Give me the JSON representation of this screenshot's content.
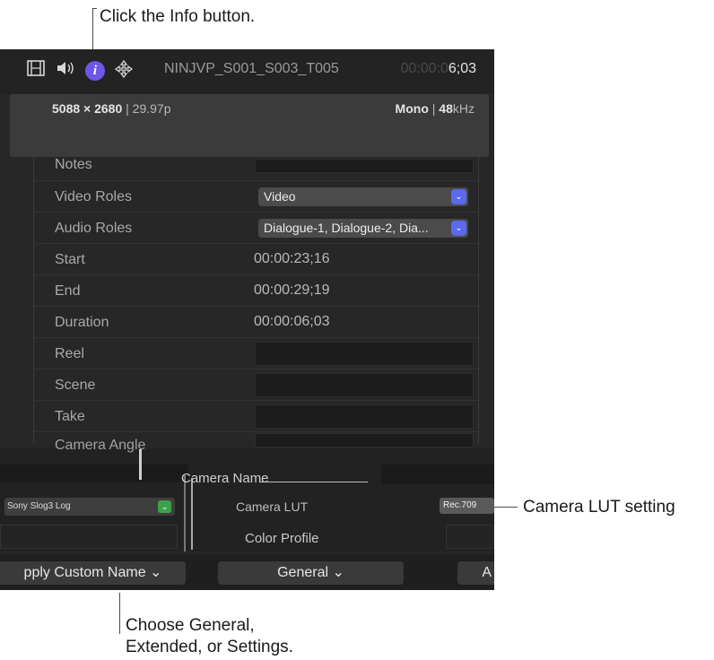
{
  "callouts": {
    "info": "Click the Info button.",
    "lut": "Camera LUT setting",
    "general_line1": "Choose General,",
    "general_line2": "Extended, or Settings."
  },
  "header": {
    "icons": [
      "film-icon",
      "speaker-icon",
      "info-icon",
      "transform-icon"
    ],
    "info_glyph": "i",
    "clip_name": "NINJVP_S001_S003_T005",
    "timecode_dim": "00:00:0",
    "timecode_bright": "6;03"
  },
  "summary": {
    "resolution": "5088 × 2680",
    "frame_rate": "29.97p",
    "audio_channels": "Mono",
    "sample_rate": "48",
    "sample_unit": "kHz"
  },
  "fields": {
    "notes_label": "Notes",
    "video_roles_label": "Video Roles",
    "video_roles_value": "Video",
    "audio_roles_label": "Audio Roles",
    "audio_roles_value": "Dialogue-1, Dialogue-2, Dia...",
    "start_label": "Start",
    "start_value": "00:00:23;16",
    "end_label": "End",
    "end_value": "00:00:29;19",
    "duration_label": "Duration",
    "duration_value": "00:00:06;03",
    "reel_label": "Reel",
    "scene_label": "Scene",
    "take_label": "Take",
    "camera_angle_label": "Camera Angle"
  },
  "overlap": {
    "camera_name_label": "Camera Name",
    "camera_lut_label": "Camera LUT",
    "color_profile_label": "Color Profile",
    "lut_left_value": "Sony Slog3 Log",
    "lut_right_value": "Rec.709"
  },
  "bottom": {
    "apply_button": "pply Custom Name ⌄",
    "general_button": "General ⌄",
    "third_button": "A"
  }
}
